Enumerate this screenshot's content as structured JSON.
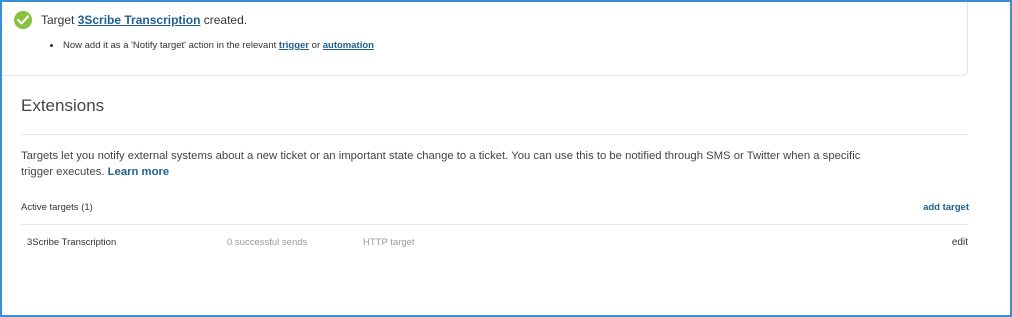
{
  "notification": {
    "prefix": "Target ",
    "target_link": "3Scribe Transcription",
    "suffix": " created.",
    "sub_text_before": "Now add it as a 'Notify target' action in the relevant ",
    "trigger_link": "trigger",
    "sub_text_or": " or ",
    "automation_link": "automation",
    "success_color": "#86c23d"
  },
  "extensions": {
    "title": "Extensions",
    "description": "Targets let you notify external systems about a new ticket or an important state change to a ticket. You can use this to be notified through SMS or Twitter when a specific trigger executes.",
    "learn_more": "Learn more",
    "active_targets_label": "Active targets (1)",
    "add_target_label": "add target",
    "targets": [
      {
        "name": "3Scribe Transcription",
        "sends": "0 successful sends",
        "type": "HTTP target",
        "action": "edit"
      }
    ]
  },
  "colors": {
    "link": "#1f5f91",
    "frame_border": "#3b8fd6",
    "muted_text": "#999999"
  }
}
